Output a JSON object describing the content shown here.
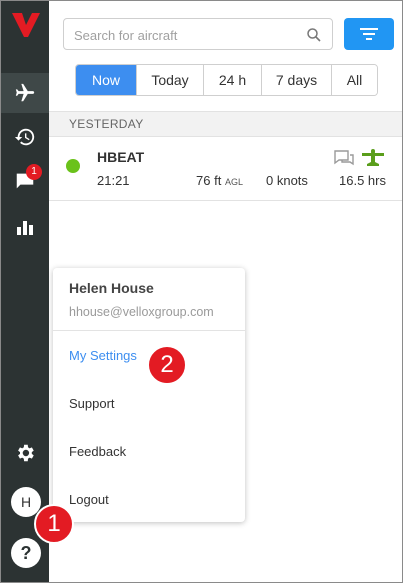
{
  "sidebar": {
    "logo_letter": "V",
    "notifications_badge": "1",
    "avatar_initial": "H",
    "help_label": "?"
  },
  "search": {
    "placeholder": "Search for aircraft",
    "value": ""
  },
  "time_filters": {
    "tabs": [
      "Now",
      "Today",
      "24 h",
      "7 days",
      "All"
    ],
    "active": "Now"
  },
  "section": {
    "label": "YESTERDAY"
  },
  "flight": {
    "registration": "HBEAT",
    "time": "21:21",
    "altitude": "76",
    "altitude_unit_ft": "ft",
    "altitude_unit_ref": "AGL",
    "speed": "0 knots",
    "hours": "16.5 hrs",
    "status_color": "#6ac21a"
  },
  "user_menu": {
    "name": "Helen House",
    "email": "hhouse@velloxgroup.com",
    "items": [
      "My Settings",
      "Support",
      "Feedback",
      "Logout"
    ]
  },
  "steps": {
    "one": "1",
    "two": "2"
  },
  "colors": {
    "sidebar": "#2c3333",
    "accent": "#2196f3",
    "tab_active": "#3d8ef0",
    "brand_red": "#e31b23",
    "aircraft_green": "#5a9e1b"
  }
}
